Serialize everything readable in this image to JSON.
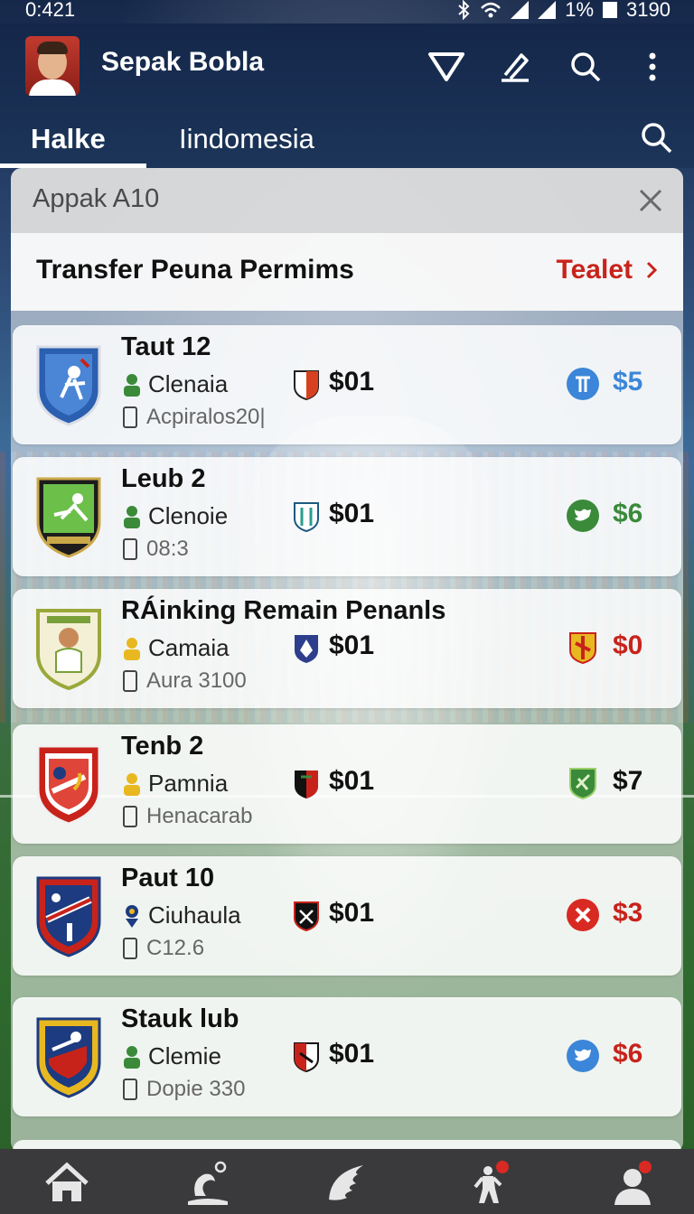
{
  "status_bar": {
    "time": "0:421",
    "battery": "1%",
    "right_text": "3190"
  },
  "app_bar": {
    "title": "Sepak Bobla",
    "icons": [
      "filter-icon",
      "edit-icon",
      "search-icon",
      "more-icon"
    ]
  },
  "tabs": [
    {
      "label": "Halke",
      "active": true
    },
    {
      "label": "Iindomesia",
      "active": false
    }
  ],
  "panel": {
    "title": "Appak A10",
    "section_title": "Transfer Peuna Permims",
    "section_link": "Tealet"
  },
  "cards": [
    {
      "name": "Taut 12",
      "sub": "Clenaia",
      "meta": "Acpiralos20|",
      "mid_value": "$01",
      "right_value": "$5",
      "right_color": "#3b86d8",
      "right_icon": "circle-badge-icon",
      "person_color": "#3a8a3a"
    },
    {
      "name": "Leub 2",
      "sub": "Clenoie",
      "meta": "08:3",
      "mid_value": "$01",
      "right_value": "$6",
      "right_color": "#3a8a3a",
      "right_icon": "bird-icon",
      "person_color": "#3a8a3a"
    },
    {
      "name": "RÁinking Remain Penanls",
      "sub": "Camaia",
      "meta": "Aura 3100",
      "mid_value": "$01",
      "right_value": "$0",
      "right_color": "#c8231b",
      "right_icon": "shield-icon",
      "person_color": "#e8b820"
    },
    {
      "name": "Tenb 2",
      "sub": "Pamnia",
      "meta": "Henacarab",
      "mid_value": "$01",
      "right_value": "$7",
      "right_color": "#111111",
      "right_icon": "shield-icon",
      "person_color": "#e8b820"
    },
    {
      "name": "Paut 10",
      "sub": "Ciuhaula",
      "meta": "C12.6",
      "mid_value": "$01",
      "right_value": "$3",
      "right_color": "#c8231b",
      "right_icon": "cross-icon",
      "person_color": "#1d3b80"
    },
    {
      "name": "Stauk lub",
      "sub": "Clemie",
      "meta": "Dopie 330",
      "mid_value": "$01",
      "right_value": "$6",
      "right_color": "#c8231b",
      "right_icon": "bird-icon",
      "person_color": "#3a8a3a"
    }
  ],
  "bottom_nav": [
    "home-icon",
    "ball-icon",
    "wing-icon",
    "player-icon",
    "profile-icon"
  ]
}
